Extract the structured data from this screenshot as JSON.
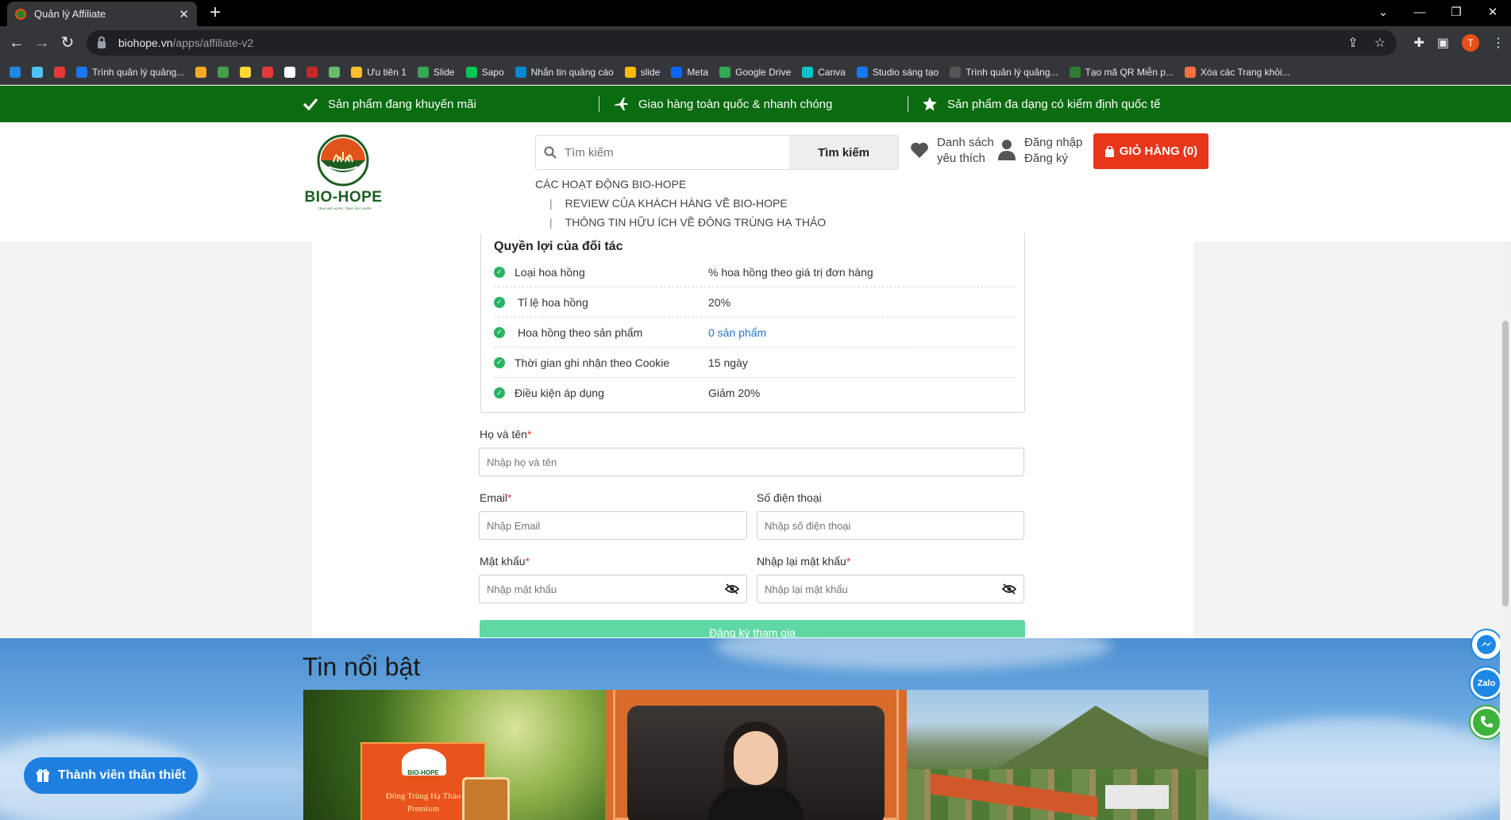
{
  "browser": {
    "tab_title": "Quản lý Affiliate",
    "url_host": "biohope.vn",
    "url_path": "/apps/affiliate-v2",
    "avatar_letter": "T",
    "bookmarks": [
      {
        "label": "",
        "color": "#1e88e5"
      },
      {
        "label": "",
        "color": "#4fc3f7"
      },
      {
        "label": "",
        "color": "#e53935"
      },
      {
        "label": "Trình quản lý quảng...",
        "color": "#1877f2"
      },
      {
        "label": "",
        "color": "#f9a825"
      },
      {
        "label": "",
        "color": "#43a047"
      },
      {
        "label": "",
        "color": "#fdd835"
      },
      {
        "label": "",
        "color": "#e53935"
      },
      {
        "label": "",
        "color": "#ffffff"
      },
      {
        "label": "",
        "color": "#c62828"
      },
      {
        "label": "",
        "color": "#66bb6a"
      },
      {
        "label": "Ưu tiên 1",
        "color": "#fbc02d"
      },
      {
        "label": "Slide",
        "color": "#34a853"
      },
      {
        "label": "Sapo",
        "color": "#00c853"
      },
      {
        "label": "Nhắn tin quảng cáo",
        "color": "#0288d1"
      },
      {
        "label": "slide",
        "color": "#fbbc04"
      },
      {
        "label": "Meta",
        "color": "#0866ff"
      },
      {
        "label": "Google Drive",
        "color": "#34a853"
      },
      {
        "label": "Canva",
        "color": "#00c4cc"
      },
      {
        "label": "Studio sáng tạo",
        "color": "#1877f2"
      },
      {
        "label": "Trình quản lý quảng...",
        "color": "#555555"
      },
      {
        "label": "Tạo mã QR Miễn p...",
        "color": "#2e7d32"
      },
      {
        "label": "Xóa các Trang khỏi...",
        "color": "#ff7043"
      }
    ]
  },
  "promo_bar": {
    "items": [
      {
        "label": "Sản phẩm đang khuyến mãi",
        "icon": "check-icon"
      },
      {
        "label": "Giao hàng toàn quốc & nhanh chóng",
        "icon": "plane-icon"
      },
      {
        "label": "Sản phẩm đa dạng có kiểm định quốc tế",
        "icon": "star-icon"
      }
    ]
  },
  "header": {
    "logo_text": "BIO-HOPE",
    "logo_tagline": "TRAO BIO-HOPE, TRAO SỨC KHỎE",
    "search_placeholder": "Tìm kiếm",
    "search_button": "Tìm kiếm",
    "favorites_line1": "Danh sách",
    "favorites_line2": "yêu thích",
    "login": "Đăng nhập",
    "register": "Đăng ký",
    "cart": "GIỎ HÀNG (0)",
    "menu": {
      "item1": "CÁC HOẠT ĐỘNG BIO-HOPE",
      "item2": "REVIEW CỦA KHÁCH HÀNG VỀ BIO-HOPE",
      "item3": "THÔNG TIN HỮU ÍCH VỀ ĐÔNG TRÙNG HẠ THẢO"
    }
  },
  "benefits": {
    "title": "Quyền lợi của đối tác",
    "rows": [
      {
        "label": "Loại hoa hồng",
        "value": "% hoa hồng theo giá trị đơn hàng"
      },
      {
        "label": "Tỉ lệ hoa hồng",
        "value": "20%"
      },
      {
        "label": "Hoa hồng theo sản phẩm",
        "value": "0 sản phẩm"
      },
      {
        "label": "Thời gian ghi nhận theo Cookie",
        "value": "15 ngày"
      },
      {
        "label": "Điều kiện áp dụng",
        "value": "Giảm 20%"
      }
    ]
  },
  "form": {
    "name_label": "Họ và tên",
    "name_placeholder": "Nhập họ và tên",
    "email_label": "Email",
    "email_placeholder": "Nhập Email",
    "phone_label": "Số điện thoại",
    "phone_placeholder": "Nhập số điện thoại",
    "password_label": "Mật khẩu",
    "password_placeholder": "Nhập mật khẩu",
    "confirm_label": "Nhập lại mật khẩu",
    "confirm_placeholder": "Nhập lại mật khẩu",
    "required_mark": "*",
    "submit": "Đăng ký tham gia"
  },
  "news": {
    "title": "Tin nổi bật",
    "thumb1_brand": "BIO-HOPE",
    "thumb1_product": "Đông Trùng Hạ Thảo",
    "thumb1_sub": "Premium"
  },
  "member_button": "Thành viên thân thiết",
  "floating": {
    "zalo": "Zalo"
  },
  "colors": {
    "green_bar": "#0b6b10",
    "cart": "#e8361b",
    "submit": "#5fd8a4",
    "check": "#28b463",
    "member": "#1e7fe0"
  }
}
